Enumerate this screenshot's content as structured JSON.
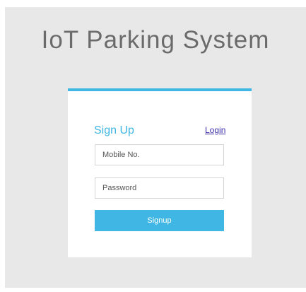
{
  "header": {
    "title": "IoT Parking System"
  },
  "signup_card": {
    "title": "Sign Up",
    "login_link": "Login",
    "mobile_field": {
      "value": "",
      "placeholder": "Mobile No."
    },
    "password_field": {
      "value": "",
      "placeholder": "Password"
    },
    "submit_label": "Signup"
  },
  "colors": {
    "accent": "#3fb6e3",
    "link": "#3c2ea8",
    "page_background": "#e8e8e8",
    "title_text": "#6b6b6b"
  }
}
